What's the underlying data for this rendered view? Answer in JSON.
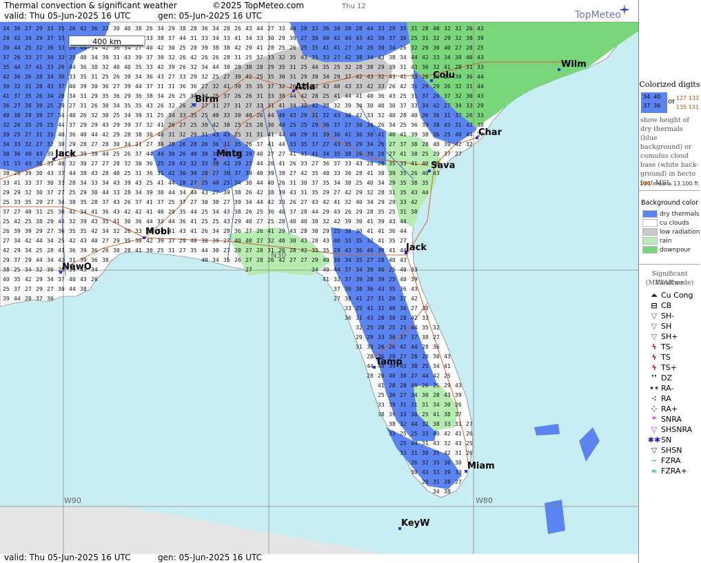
{
  "header": {
    "title": "Thermal convection & significant weather",
    "copyright": "©2025 TopMeteo.com",
    "day_tab": "Thu 12",
    "valid": "valid:  Thu  05-Jun-2025  16 UTC",
    "gen": "gen: 05-Jun-2025 16 UTC",
    "logo": "TopMeteo"
  },
  "footer": {
    "valid": "valid:  Thu  05-Jun-2025  16 UTC",
    "gen": "gen: 05-Jun-2025 16 UTC"
  },
  "map": {
    "scale_label": "400 km",
    "grid_labels": [
      "W90",
      "W80",
      "N30"
    ],
    "cities": [
      {
        "name": "Wilm"
      },
      {
        "name": "Colu"
      },
      {
        "name": "Atla"
      },
      {
        "name": "Birm"
      },
      {
        "name": "Char"
      },
      {
        "name": "Mntg"
      },
      {
        "name": "Jack"
      },
      {
        "name": "Sava"
      },
      {
        "name": "Mobi"
      },
      {
        "name": "Jack"
      },
      {
        "name": "NewO"
      },
      {
        "name": "Tamp"
      },
      {
        "name": "Miam"
      },
      {
        "name": "KeyW"
      }
    ],
    "colors": {
      "sea": "#c8eef4",
      "land_cu": "#ffffff",
      "dry": "#5b84f0",
      "low_rad": "#c8c8c8",
      "rain": "#b6ecb0",
      "downpour": "#7ad67a",
      "roads": "#d4622a",
      "rivers": "#3a5fd0"
    }
  },
  "legend": {
    "colorized_title": "Colorized digits",
    "sample_blue": [
      "34",
      "40",
      "37",
      "36"
    ],
    "or": "or",
    "sample_white": [
      "127",
      "133",
      "135",
      "131"
    ],
    "description": "show height of dry thermals (blue background) or cumulus cloud base (white back-ground) in hecto feet MSL",
    "note_value": "131",
    "note_text": "means 13.100 ft",
    "bg_title": "Background color",
    "bg_items": [
      {
        "label": "dry thermals",
        "color": "#5b84f0"
      },
      {
        "label": "cu clouds",
        "color": "#ffffff"
      },
      {
        "label": "low radiation",
        "color": "#c8c8c8"
      },
      {
        "label": "rain",
        "color": "#b6ecb0"
      },
      {
        "label": "downpour",
        "color": "#7ad67a"
      }
    ],
    "sig_title": "Significant Weather",
    "sig_subtitle": "(METAR code)",
    "wx_items": [
      {
        "label": "Cu Cong",
        "sym": "⏶",
        "color": "#000"
      },
      {
        "label": "CB",
        "sym": "⊟",
        "color": "#000"
      },
      {
        "label": "SH-",
        "sym": "▽",
        "color": "#2a8a2a"
      },
      {
        "label": "SH",
        "sym": "▽",
        "color": "#2a8a2a"
      },
      {
        "label": "SH+",
        "sym": "▽",
        "color": "#2a8a2a"
      },
      {
        "label": "TS-",
        "sym": "ϟ",
        "color": "#c02020"
      },
      {
        "label": "TS",
        "sym": "ϟ",
        "color": "#c02020"
      },
      {
        "label": "TS+",
        "sym": "ϟ",
        "color": "#c02020"
      },
      {
        "label": "DZ",
        "sym": "❜❜",
        "color": "#1a5a1a"
      },
      {
        "label": "RA-",
        "sym": "••",
        "color": "#1a5a1a"
      },
      {
        "label": "RA",
        "sym": "⁖",
        "color": "#1a5a1a"
      },
      {
        "label": "RA+",
        "sym": "⁘",
        "color": "#1a5a1a"
      },
      {
        "label": "SNRA",
        "sym": "*",
        "color": "#c020c0"
      },
      {
        "label": "SHSNRA",
        "sym": "▽",
        "color": "#c020c0"
      },
      {
        "label": "SN",
        "sym": "✱✱",
        "color": "#2020c0"
      },
      {
        "label": "SHSN",
        "sym": "▽",
        "color": "#2020c0"
      },
      {
        "label": "FZRA",
        "sym": "~",
        "color": "#20b0c0"
      },
      {
        "label": "FZRA+",
        "sym": "≈",
        "color": "#20b0c0"
      }
    ]
  }
}
